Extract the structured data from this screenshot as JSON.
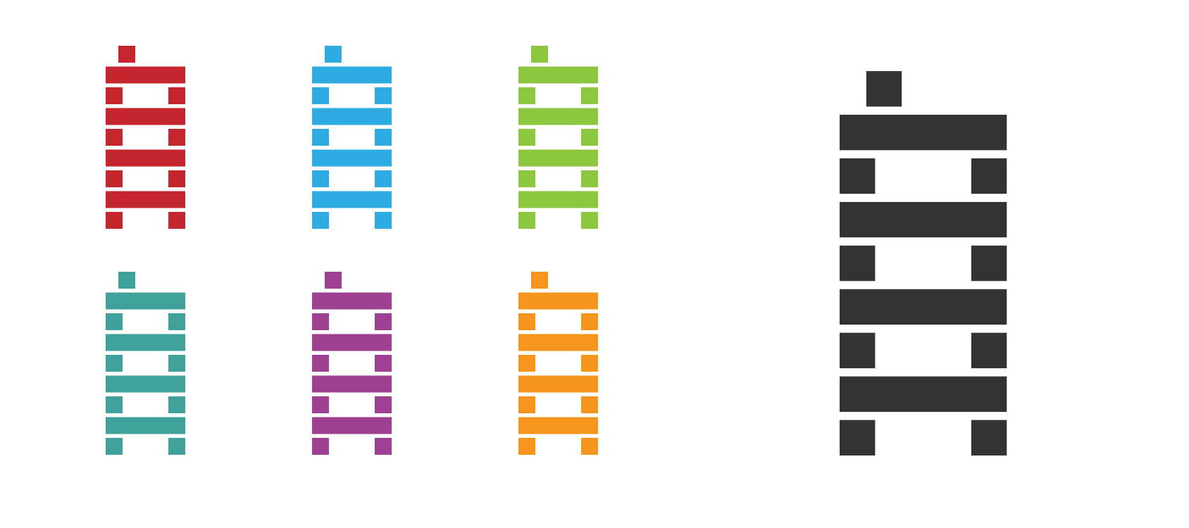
{
  "icons": [
    {
      "name": "jenga-tower-icon-red",
      "color": "#C4262E"
    },
    {
      "name": "jenga-tower-icon-blue",
      "color": "#2DABE2"
    },
    {
      "name": "jenga-tower-icon-green",
      "color": "#8DC63F"
    },
    {
      "name": "jenga-tower-icon-teal",
      "color": "#40A19C"
    },
    {
      "name": "jenga-tower-icon-purple",
      "color": "#9E3F8F"
    },
    {
      "name": "jenga-tower-icon-orange",
      "color": "#F7941D"
    },
    {
      "name": "jenga-tower-icon-large",
      "color": "#333333"
    }
  ]
}
